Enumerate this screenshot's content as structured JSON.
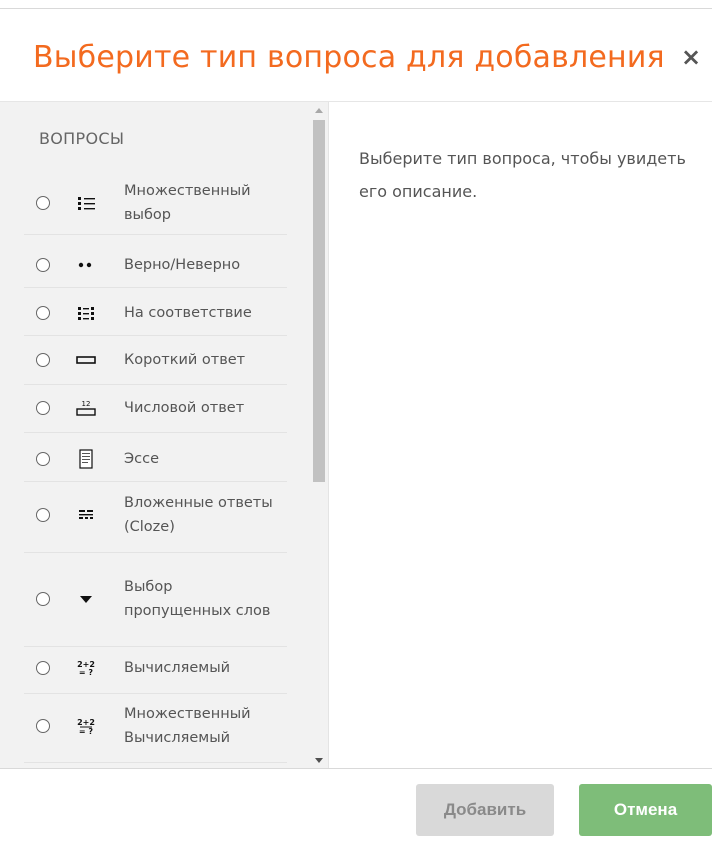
{
  "dialog": {
    "title": "Выберите тип вопроса для добавления",
    "close_symbol": "×"
  },
  "options": {
    "section_label": "ВОПРОСЫ",
    "items": [
      {
        "label": "Множественный выбор",
        "icon": "multiple-choice-icon"
      },
      {
        "label": "Верно/Неверно",
        "icon": "true-false-icon"
      },
      {
        "label": "На соответствие",
        "icon": "matching-icon"
      },
      {
        "label": "Короткий ответ",
        "icon": "short-answer-icon"
      },
      {
        "label": "Числовой ответ",
        "icon": "numerical-icon"
      },
      {
        "label": "Эссе",
        "icon": "essay-icon"
      },
      {
        "label": "Вложенные ответы (Cloze)",
        "icon": "cloze-icon"
      },
      {
        "label": "Выбор пропущенных слов",
        "icon": "dropdown-icon"
      },
      {
        "label": "Вычисляемый",
        "icon": "calculated-icon"
      },
      {
        "label": "Множественный Вычисляемый",
        "icon": "calculated-multi-icon"
      }
    ]
  },
  "description": {
    "text": "Выберите тип вопроса, чтобы увидеть его описание."
  },
  "footer": {
    "add_label": "Добавить",
    "cancel_label": "Отмена"
  },
  "colors": {
    "title": "#f36a1f",
    "cancel_button": "#7ebd79",
    "add_button_disabled": "#d9d9d9"
  }
}
